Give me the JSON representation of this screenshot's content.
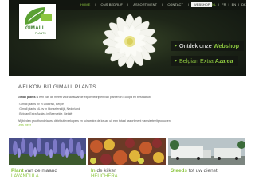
{
  "nav": {
    "items": [
      "HOME",
      "ONS BEDRIJF",
      "ASSORTIMENT",
      "CONTACT",
      "VACATURE"
    ],
    "webshop": "WEBSHOP",
    "languages": [
      "NL",
      "FR",
      "EN",
      "DK"
    ]
  },
  "logo": {
    "name": "GIMALL",
    "tagline": "PLANTS"
  },
  "promos": [
    {
      "text": "Ontdek onze",
      "highlight": "Webshop"
    },
    {
      "text": "Belgian Extra",
      "highlight": "Azalea"
    }
  ],
  "welcome": {
    "title": "WELKOM BIJ GIMALL PLANTS",
    "intro_bold": "Gimall plants",
    "intro_rest": " is een van de meest vooraanstaande exportbedrijven van planten in Europa en bestaat uit:",
    "bullets": [
      "Gimall plants nv in Lochristi, België",
      "Gimall plants NL bv in Honselersdijk, Nederland",
      "Belgian Extra Azalea in Beervelde, België"
    ],
    "outro": "Wij bieden groothandelaars, distributieverkopers en tuincentra de keuze uit een totaal assortiment van sierteeltproducten.",
    "read_more": "Lees meer"
  },
  "tiles": [
    {
      "green": "Plant",
      "dark": " van de maand",
      "sub": "LAVANDULA"
    },
    {
      "green": "In",
      "dark": " de kijker",
      "sub": "HEUCHERA"
    },
    {
      "green": "Steeds",
      "dark": " tot uw dienst",
      "sub": ""
    }
  ],
  "colors": {
    "accent": "#8cc63f",
    "dark": "#1e2618"
  }
}
